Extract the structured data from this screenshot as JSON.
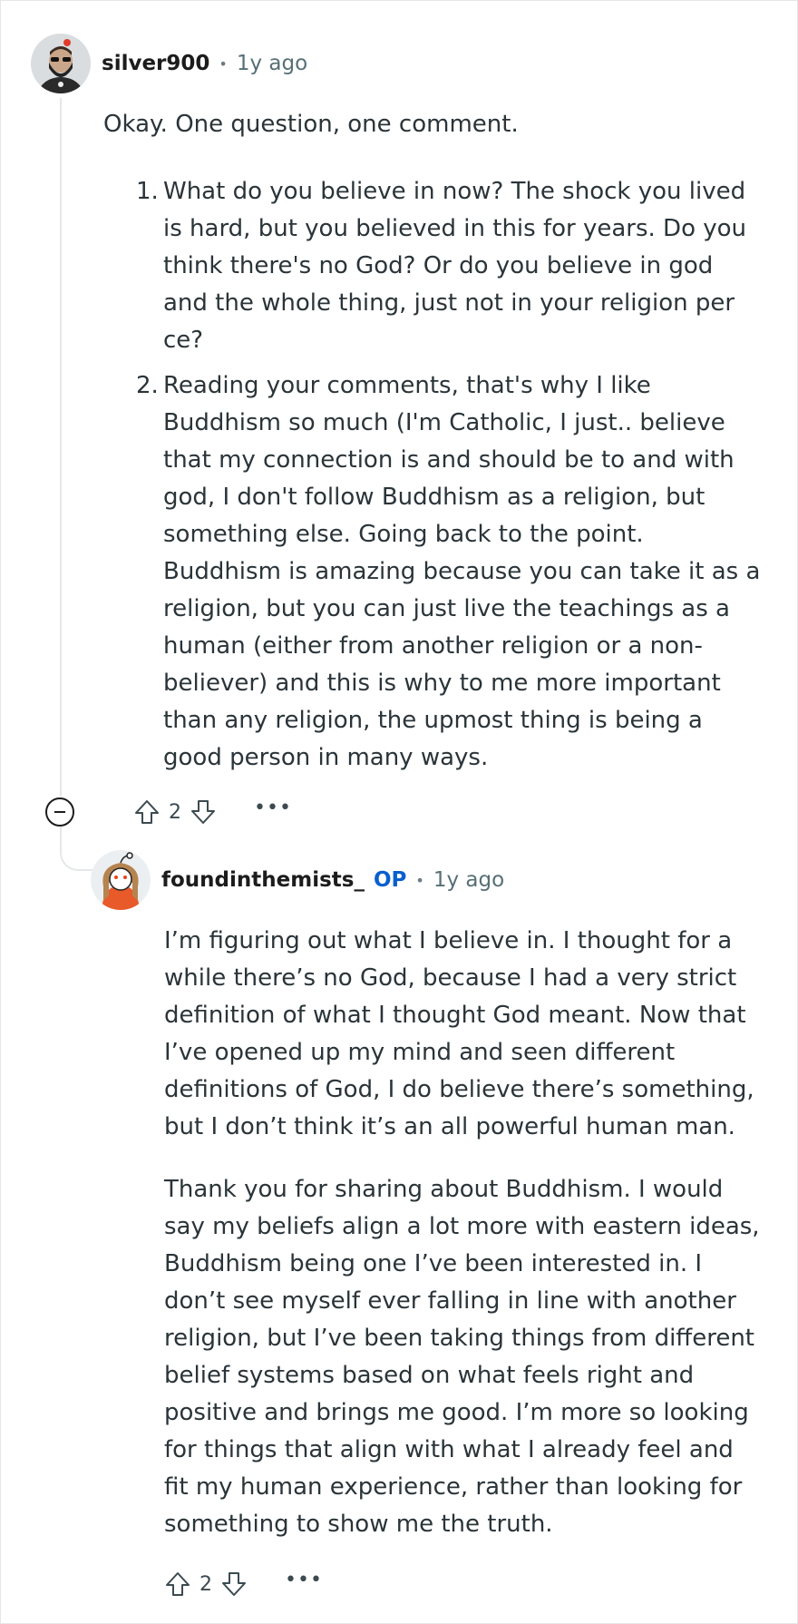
{
  "comment": {
    "username": "silver900",
    "separator": "•",
    "time": "1y ago",
    "intro": "Okay. One question, one comment.",
    "items": [
      {
        "number": "1.",
        "lines": [
          "What do you believe in now? The shock you lived",
          "is hard, but you believed in this for years. Do you",
          "think there's no God? Or do you believe in god",
          "and the whole thing, just not in your religion per",
          "ce?"
        ]
      },
      {
        "number": "2.",
        "lines": [
          "Reading your comments, that's why I like",
          "Buddhism so much (I'm Catholic, I just.. believe",
          "that my connection is and should be to and with",
          "god, I don't follow Buddhism as a religion, but",
          "something else. Going back to the point.",
          "Buddhism is amazing because you can take it as a",
          "religion, but you can just live the teachings as a",
          "human (either from another religion or a non-",
          "believer) and this is why to me more important",
          "than any religion, the upmost thing is being a",
          "good person in many ways."
        ]
      }
    ],
    "actions": {
      "vote_count": "2",
      "more": "•••"
    }
  },
  "reply": {
    "username": "foundinthemists_",
    "op_badge": "OP",
    "separator": "•",
    "time": "1y ago",
    "paragraphs": [
      {
        "lines": [
          "I’m figuring out what I believe in. I thought for a",
          "while there’s no God, because I had a very strict",
          "definition of what I thought God meant. Now that",
          "I’ve opened up my mind and seen different",
          "definitions of God, I do believe there’s something,",
          "but I don’t think it’s an all powerful human man."
        ]
      },
      {
        "lines": [
          "Thank you for sharing about Buddhism. I would",
          "say my beliefs align a lot more with eastern ideas,",
          "Buddhism being one I’ve been interested in. I",
          "don’t see myself ever falling in line with another",
          "religion, but I’ve been taking things from different",
          "belief systems based on what feels right and",
          "positive and brings me good. I’m more so looking",
          "for things that align with what I already feel and",
          "fit my human experience, rather than looking for",
          "something to show me the truth."
        ]
      }
    ],
    "actions": {
      "vote_count": "2",
      "more": "•••"
    }
  },
  "icons": {
    "collapse": "minus-circle-icon",
    "upvote": "arrow-up-outline-icon",
    "downvote": "arrow-down-outline-icon",
    "more": "ellipsis-icon"
  },
  "colors": {
    "op_badge": "#0a5fcf",
    "thread_line": "#e5e7e9",
    "meta_text": "#576f76"
  }
}
